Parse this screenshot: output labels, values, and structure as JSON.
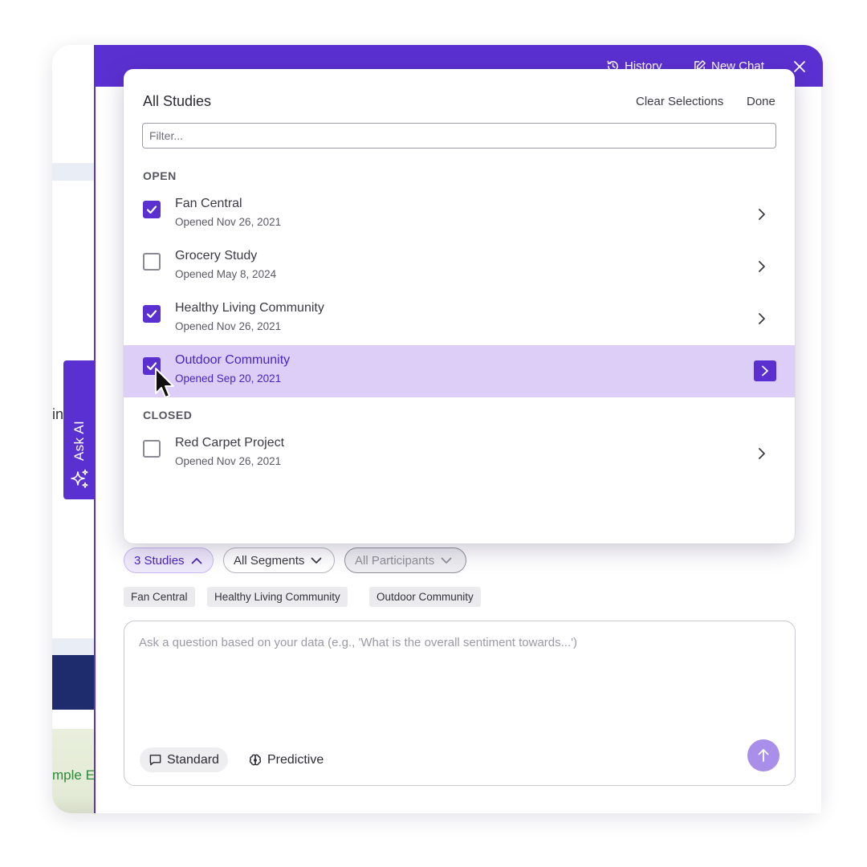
{
  "background": {
    "text_fragment": "in",
    "green_text": "mple E"
  },
  "ask_ai": {
    "label": "Ask AI"
  },
  "header": {
    "history_label": "History",
    "new_chat_label": "New Chat"
  },
  "dropdown": {
    "title": "All Studies",
    "clear_label": "Clear Selections",
    "done_label": "Done",
    "filter_placeholder": "Filter...",
    "sections": [
      {
        "label": "OPEN",
        "items": [
          {
            "name": "Fan Central",
            "date": "Opened Nov 26, 2021",
            "checked": true,
            "highlight": false
          },
          {
            "name": "Grocery Study",
            "date": "Opened May 8, 2024",
            "checked": false,
            "highlight": false
          },
          {
            "name": "Healthy Living Community",
            "date": "Opened Nov 26, 2021",
            "checked": true,
            "highlight": false
          },
          {
            "name": "Outdoor Community",
            "date": "Opened Sep 20, 2021",
            "checked": true,
            "highlight": true
          }
        ]
      },
      {
        "label": "CLOSED",
        "items": [
          {
            "name": "Red Carpet Project",
            "date": "Opened Nov 26, 2021",
            "checked": false,
            "highlight": false
          }
        ]
      }
    ]
  },
  "filters": {
    "studies_label": "3 Studies",
    "segments_label": "All Segments",
    "participants_label": "All Participants"
  },
  "selected_tags": [
    "Fan Central",
    "Healthy Living Community",
    "Outdoor Community"
  ],
  "question": {
    "placeholder": "Ask a question based on your data (e.g., 'What is the overall sentiment towards...')",
    "standard_label": "Standard",
    "predictive_label": "Predictive"
  },
  "colors": {
    "accent": "#5b30d1",
    "highlight_row": "#dccef6",
    "send_button": "#a98fe9"
  }
}
